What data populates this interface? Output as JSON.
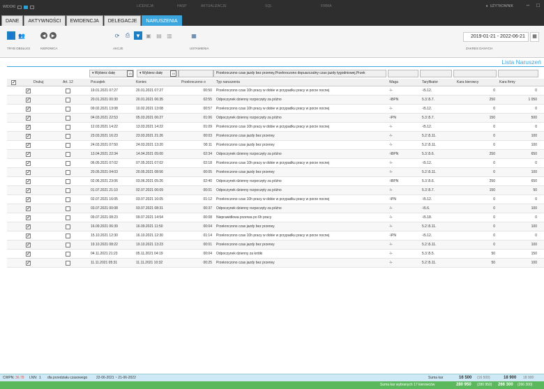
{
  "titlebar": {
    "views_label": "WIDOKI",
    "menu": [
      "LICENCJA",
      "HASP",
      "AKTUALIZACJE",
      "SQL",
      "FIRMA"
    ],
    "user_label": "UŻYTKOWNIK"
  },
  "tabs": [
    {
      "label": "DANE",
      "active": false
    },
    {
      "label": "AKTYWNOŚCI",
      "active": false
    },
    {
      "label": "EWIDENCJA",
      "active": false
    },
    {
      "label": "DELEGACJE",
      "active": false
    },
    {
      "label": "NARUSZENIA",
      "active": true
    }
  ],
  "ribbon": {
    "groups": [
      "TRYB OBSŁUGI",
      "KIEROWCA",
      "AKCJE",
      "USTAWIENIA"
    ],
    "date_range": "2019-01-21 - 2022-06-21",
    "date_range_label": "ZAKRES DANYCH"
  },
  "list_title": "Lista Naruszeń",
  "filters": {
    "start_placeholder": "Wybierz datę",
    "end_placeholder": "Wybierz datę",
    "cal": "15",
    "type_filter": "Przekroczono czas jazdy bez przerwy,Przekroczono dopuszczalny czas jazdy tygodniowej,Przek"
  },
  "columns": {
    "druk": "Drukuj",
    "art": "Art. 12",
    "start": "Początek",
    "end": "Koniec",
    "over": "Przekroczono o",
    "type": "Typ naruszenia",
    "weight": "Waga",
    "tariff": "Taryfikator",
    "kk": "Kara kierowcy",
    "kf": "Kara firmy"
  },
  "rows": [
    {
      "start": "19.01.2021 07:27",
      "end": "20.01.2021 07:27",
      "over": "00:50",
      "type": "Przekroczono czas 10h pracy w dobie w przypadku pracy w porze nocnej",
      "weight": "-\\-",
      "tariff": "-\\5.12.",
      "kk": "0",
      "kf": "0"
    },
    {
      "start": "20.01.2021 00:30",
      "end": "20.01.2021 06:35",
      "over": "02:55",
      "type": "Odpoczynek dzienny rozpoczęty za późno",
      "weight": "-\\BPN",
      "tariff": "5.3.\\5.7.",
      "kk": "250",
      "kf": "1 050"
    },
    {
      "start": "09.02.2021 13:08",
      "end": "10.02.2021 13:08",
      "over": "00:57",
      "type": "Przekroczono czas 10h pracy w dobie w przypadku pracy w porze nocnej",
      "weight": "-\\-",
      "tariff": "-\\5.12.",
      "kk": "0",
      "kf": "0"
    },
    {
      "start": "04.03.2021 22:53",
      "end": "05.03.2021 06:27",
      "over": "01:06",
      "type": "Odpoczynek dzienny rozpoczęty za późno",
      "weight": "-\\PN",
      "tariff": "5.3.\\5.7.",
      "kk": "150",
      "kf": "500"
    },
    {
      "start": "12.03.2021 14:22",
      "end": "13.03.2021 14:22",
      "over": "01:09",
      "type": "Przekroczono czas 10h pracy w dobie w przypadku pracy w porze nocnej",
      "weight": "-\\-",
      "tariff": "-\\5.12.",
      "kk": "0",
      "kf": "0"
    },
    {
      "start": "23.03.2021 16:23",
      "end": "23.03.2021 21:26",
      "over": "00:03",
      "type": "Przekroczono czas jazdy bez przerwy",
      "weight": "-\\-",
      "tariff": "5.2.\\5.11.",
      "kk": "0",
      "kf": "100"
    },
    {
      "start": "24.03.2021 07:50",
      "end": "24.03.2021 13:20",
      "over": "00:11",
      "type": "Przekroczono czas jazdy bez przerwy",
      "weight": "-\\-",
      "tariff": "5.2.\\5.11.",
      "kk": "0",
      "kf": "100"
    },
    {
      "start": "13.04.2021 22:34",
      "end": "14.04.2021 05:00",
      "over": "02:34",
      "type": "Odpoczynek dzienny rozpoczęty za późno",
      "weight": "-\\BPN",
      "tariff": "5.3.\\5.6.",
      "kk": "250",
      "kf": "650"
    },
    {
      "start": "06.05.2021 07:02",
      "end": "07.05.2021 07:02",
      "over": "02:18",
      "type": "Przekroczono czas 10h pracy w dobie w przypadku pracy w porze nocnej",
      "weight": "-\\-",
      "tariff": "-\\5.12.",
      "kk": "0",
      "kf": "0"
    },
    {
      "start": "20.05.2021 04:03",
      "end": "20.05.2021 08:56",
      "over": "00:05",
      "type": "Przekroczono czas jazdy bez przerwy",
      "weight": "-\\-",
      "tariff": "5.2.\\5.11.",
      "kk": "0",
      "kf": "100"
    },
    {
      "start": "02.06.2021 23:06",
      "end": "03.06.2021 05:26",
      "over": "02:40",
      "type": "Odpoczynek dzienny rozpoczęty za późno",
      "weight": "-\\BPN",
      "tariff": "5.3.\\5.6.",
      "kk": "250",
      "kf": "650"
    },
    {
      "start": "01.07.2021 21:10",
      "end": "02.07.2021 06:09",
      "over": "00:01",
      "type": "Odpoczynek dzienny rozpoczęty za późno",
      "weight": "-\\-",
      "tariff": "5.3.\\5.7.",
      "kk": "150",
      "kf": "50"
    },
    {
      "start": "02.07.2021 16:05",
      "end": "03.07.2021 16:05",
      "over": "01:12",
      "type": "Przekroczono czas 10h pracy w dobie w przypadku pracy w porze nocnej",
      "weight": "-\\PN",
      "tariff": "-\\5.12.",
      "kk": "0",
      "kf": "0"
    },
    {
      "start": "03.07.2021 00:08",
      "end": "03.07.2021 08:31",
      "over": "00:37",
      "type": "Odpoczynek dzienny rozpoczęty za późno",
      "weight": "-\\-",
      "tariff": "-\\5.6.",
      "kk": "0",
      "kf": "100"
    },
    {
      "start": "09.07.2021 08:23",
      "end": "09.07.2021 14:54",
      "over": "00:08",
      "type": "Nieprawidłowa przerwa po 6h pracy",
      "weight": "-\\-",
      "tariff": "-\\5.18.",
      "kk": "0",
      "kf": "0"
    },
    {
      "start": "16.09.2021 06:39",
      "end": "16.09.2021 11:50",
      "over": "00:04",
      "type": "Przekroczono czas jazdy bez przerwy",
      "weight": "-\\-",
      "tariff": "5.2.\\5.11.",
      "kk": "0",
      "kf": "100"
    },
    {
      "start": "15.10.2021 12:30",
      "end": "16.10.2021 12:30",
      "over": "01:14",
      "type": "Przekroczono czas 10h pracy w dobie w przypadku pracy w porze nocnej",
      "weight": "-\\PN",
      "tariff": "-\\5.12.",
      "kk": "0",
      "kf": "0"
    },
    {
      "start": "19.10.2021 08:22",
      "end": "19.10.2021 13:23",
      "over": "00:01",
      "type": "Przekroczono czas jazdy bez przerwy",
      "weight": "-\\-",
      "tariff": "5.2.\\5.11.",
      "kk": "0",
      "kf": "100"
    },
    {
      "start": "04.11.2021 21:23",
      "end": "05.11.2021 04:19",
      "over": "00:04",
      "type": "Odpoczynek dzienny za krótki",
      "weight": "-\\-",
      "tariff": "5.3.\\5.5.",
      "kk": "50",
      "kf": "150"
    },
    {
      "start": "11.11.2021 05:31",
      "end": "11.11.2021 10:32",
      "over": "00:25",
      "type": "Przekroczono czas jazdy bez przerwy",
      "weight": "-\\-",
      "tariff": "5.2.\\5.11.",
      "kk": "50",
      "kf": "100"
    }
  ],
  "footer": {
    "cwpn_label": "CWPN:",
    "cwpn_value": "36.78",
    "lnn_label": "LNN:",
    "lnn_value": "1",
    "period_label": "dla przedziału czasowego",
    "period_value": "22-06-2021 ~ 21-06-2022",
    "suma_label": "Suma kar",
    "suma_kk": "16 500",
    "suma_kk_paren": "(16 500)",
    "suma_kf": "18 900",
    "suma_kf_plain": "18 900",
    "wybr_label": "Suma kar wybranych 17 kierowców",
    "wybr_kk": "280 950",
    "wybr_kk_paren": "(280 950)",
    "wybr_kf": "266 300",
    "wybr_kf_paren": "(266 300)"
  }
}
